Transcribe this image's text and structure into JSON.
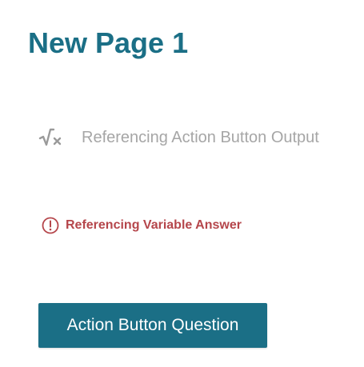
{
  "page": {
    "title": "New Page 1"
  },
  "formula_field": {
    "icon": "square-root-x-icon",
    "label": "Referencing Action Button Output"
  },
  "error_field": {
    "icon": "exclamation-circle-icon",
    "label": "Referencing Variable Answer"
  },
  "action_button": {
    "label": "Action Button Question"
  },
  "colors": {
    "accent": "#1b6f86",
    "muted_text": "#a6a6a6",
    "error": "#b5464b",
    "background": "#ffffff"
  }
}
